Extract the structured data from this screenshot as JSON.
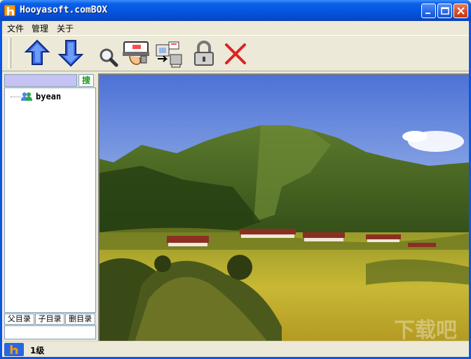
{
  "window": {
    "title": "Hooyasoft.comBOX"
  },
  "menu": [
    "文件",
    "管理",
    "关于"
  ],
  "toolbar": {
    "tools": [
      "up-arrow-icon",
      "down-arrow-icon",
      "magnifier-icon",
      "send-mail-icon",
      "transfer-icon",
      "lock-icon",
      "delete-icon"
    ]
  },
  "sidebar": {
    "search_value": "",
    "search_button": "搜",
    "tree_items": [
      {
        "label": "byean",
        "icon": "user-icon"
      }
    ],
    "dir_buttons": [
      "父目录",
      "子目录",
      "删目录"
    ],
    "path_value": ""
  },
  "viewer": {
    "image": "mountain-landscape-photo"
  },
  "status": {
    "text": "1级"
  }
}
